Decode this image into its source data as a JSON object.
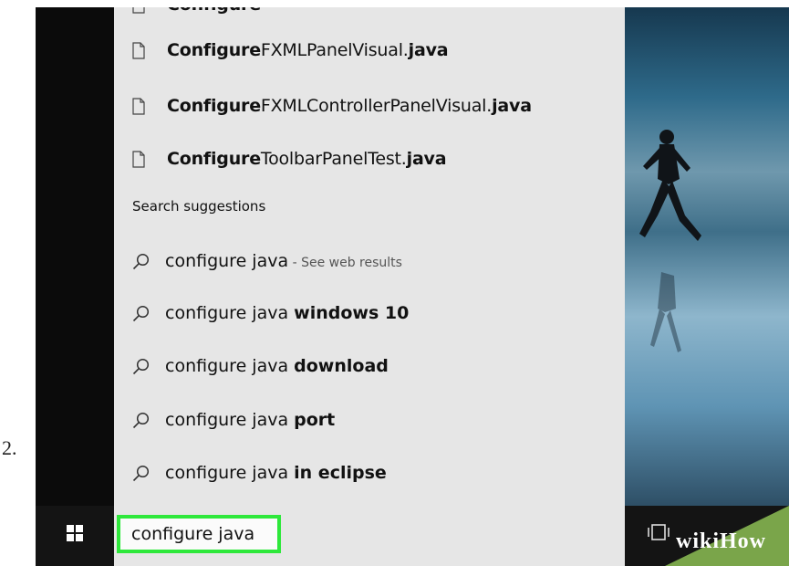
{
  "step": {
    "number": "2."
  },
  "results": {
    "files": [
      {
        "bold": "Configure",
        "rest": "FXMLPanelVisual.",
        "ext": "java"
      },
      {
        "bold": "Configure",
        "rest": "FXMLControllerPanelVisual.",
        "ext": "java"
      },
      {
        "bold": "Configure",
        "rest": "ToolbarPanelTest.",
        "ext": "java"
      }
    ],
    "section_label": "Search suggestions",
    "suggestions": [
      {
        "base": "configure java",
        "bold": "",
        "hint": " - See web results"
      },
      {
        "base": "configure java ",
        "bold": "windows 10",
        "hint": ""
      },
      {
        "base": "configure java ",
        "bold": "download",
        "hint": ""
      },
      {
        "base": "configure java ",
        "bold": "port",
        "hint": ""
      },
      {
        "base": "configure java ",
        "bold": "in eclipse",
        "hint": ""
      }
    ]
  },
  "taskbar": {
    "search_value": "configure java",
    "start_icon": "windows-logo-icon",
    "taskview_icon": "task-view-icon",
    "accent_color": "#2ee83b"
  },
  "watermark": {
    "wiki": "wiki",
    "how": "How"
  }
}
